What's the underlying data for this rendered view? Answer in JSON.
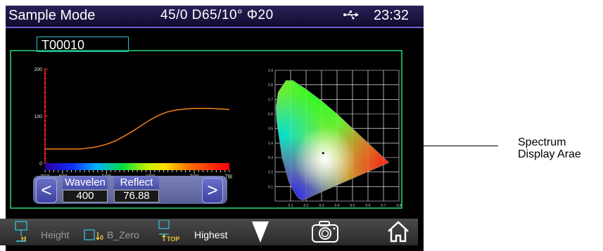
{
  "header": {
    "mode": "Sample Mode",
    "conditions": "45/0  D65/10°  Φ20",
    "usb_icon": "usb-icon",
    "time": "23:32"
  },
  "sample_id": "T00010",
  "chart_data": [
    {
      "type": "line",
      "title": "",
      "xlabel": "",
      "ylabel": "",
      "xlim": [
        360,
        780
      ],
      "ylim": [
        0,
        200
      ],
      "x_ticks": [
        "360",
        "400",
        "500",
        "600",
        "700",
        "780"
      ],
      "y_ticks": [
        "0",
        "100",
        "200"
      ],
      "series": [
        {
          "color": "#f08020",
          "x": [
            360,
            400,
            440,
            460,
            480,
            500,
            520,
            540,
            560,
            580,
            600,
            620,
            640,
            660,
            680,
            700,
            720,
            740,
            760,
            780
          ],
          "y": [
            30,
            30,
            30,
            32,
            35,
            40,
            47,
            57,
            68,
            80,
            92,
            102,
            109,
            113,
            115,
            116,
            116,
            116,
            115,
            114
          ]
        }
      ]
    },
    {
      "type": "scatter",
      "title": "",
      "xlabel": "",
      "ylabel": "",
      "xlim": [
        0,
        0.8
      ],
      "ylim": [
        0,
        0.9
      ],
      "x_ticks": [
        "0.1",
        "0.2",
        "0.3",
        "0.4",
        "0.5",
        "0.6",
        "0.7",
        "0.8"
      ],
      "y_ticks": [
        "0.1",
        "0.2",
        "0.3",
        "0.4",
        "0.5",
        "0.6",
        "0.7",
        "0.8",
        "0.9"
      ],
      "grid": true,
      "locus": [
        [
          0.175,
          0.005
        ],
        [
          0.17,
          0.01
        ],
        [
          0.15,
          0.02
        ],
        [
          0.125,
          0.06
        ],
        [
          0.09,
          0.13
        ],
        [
          0.045,
          0.3
        ],
        [
          0.01,
          0.55
        ],
        [
          0.005,
          0.65
        ],
        [
          0.02,
          0.75
        ],
        [
          0.07,
          0.83
        ],
        [
          0.115,
          0.83
        ],
        [
          0.2,
          0.77
        ],
        [
          0.3,
          0.69
        ],
        [
          0.4,
          0.6
        ],
        [
          0.5,
          0.5
        ],
        [
          0.6,
          0.4
        ],
        [
          0.7,
          0.3
        ],
        [
          0.735,
          0.265
        ]
      ],
      "sample_point": [
        0.31,
        0.33
      ]
    }
  ],
  "nav": {
    "prev": "<",
    "next": ">",
    "wavelength_label": "Wavelen",
    "wavelength_value": "400",
    "reflect_label": "Reflect",
    "reflect_value": "76.88"
  },
  "toolbar": {
    "height_label": "Height",
    "bzero_label": "B_Zero",
    "highest_label": "Highest",
    "colors": {
      "icon": "#2fb0c8",
      "sub": "#e8c23a"
    }
  },
  "annotation": {
    "line1": "Spectrum",
    "line2": "Display Arae"
  }
}
